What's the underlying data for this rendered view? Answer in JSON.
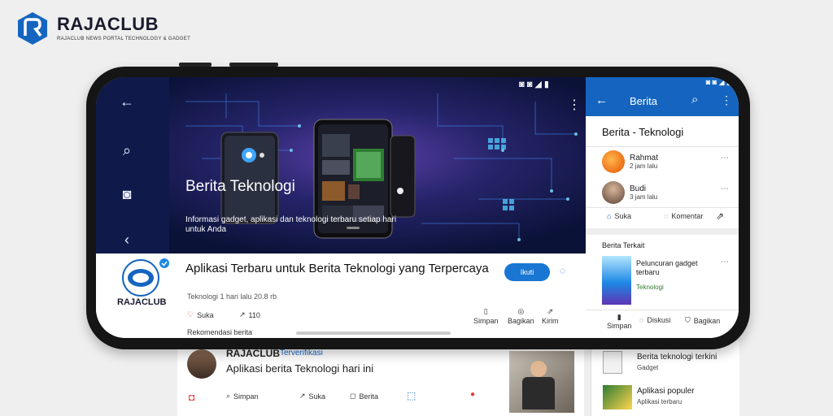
{
  "brand": {
    "name": "RAJACLUB",
    "tagline": "RAJACLUB NEWS PORTAL TECHNOLOGY & GADGET"
  },
  "status_bar": {
    "icons": "◙ ◙ ◢ ▮"
  },
  "hero": {
    "title": "Berita Teknologi",
    "subtitle": "Informasi gadget, aplikasi dan teknologi terbaru setiap hari untuk Anda"
  },
  "article": {
    "source_name": "RAJACLUB",
    "title": "Aplikasi Terbaru untuk Berita Teknologi yang Terpercaya",
    "meta": "Teknologi 1 hari lalu 20.8 rb",
    "follow_label": "Ikuti",
    "likes_label": "Suka",
    "shares_count": "110",
    "actions": [
      {
        "label": "Simpan"
      },
      {
        "label": "Bagikan"
      },
      {
        "label": "Kirim"
      }
    ],
    "next_item": "Rekomendasi berita"
  },
  "right_panel": {
    "header_title": "Berita",
    "card_title": "Berita - Teknologi",
    "items": [
      {
        "name": "Rahmat",
        "sub": "2 jam lalu"
      },
      {
        "name": "Budi",
        "sub": "3 jam lalu"
      }
    ],
    "card_actions": [
      "Suka",
      "Komentar",
      "Bagikan"
    ],
    "section_title": "Berita Terkait",
    "related": [
      {
        "title": "Peluncuran gadget terbaru",
        "sub": "Teknologi"
      }
    ],
    "bottom_actions": [
      "Simpan",
      "Diskusi",
      "Bagikan"
    ],
    "below_items": [
      {
        "title": "Berita teknologi terkini",
        "sub": "Gadget"
      },
      {
        "title": "Aplikasi populer",
        "sub": "Aplikasi terbaru"
      }
    ]
  },
  "below": {
    "user": "RAJACLUB",
    "badge": "Terverifikasi",
    "text": "Aplikasi berita Teknologi hari ini",
    "actions": [
      "Simpan",
      "Suka",
      "Berita"
    ]
  }
}
